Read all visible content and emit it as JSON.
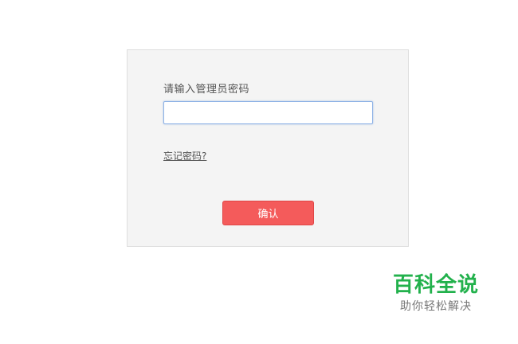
{
  "login": {
    "prompt": "请输入管理员密码",
    "password_value": "",
    "forgot_link": "忘记密码?",
    "confirm_label": "确认"
  },
  "watermark": {
    "title": "百科全说",
    "subtitle": "助你轻松解决"
  },
  "colors": {
    "confirm_button": "#f45b5b",
    "panel_background": "#f4f4f4",
    "watermark_green": "#22b14c"
  }
}
